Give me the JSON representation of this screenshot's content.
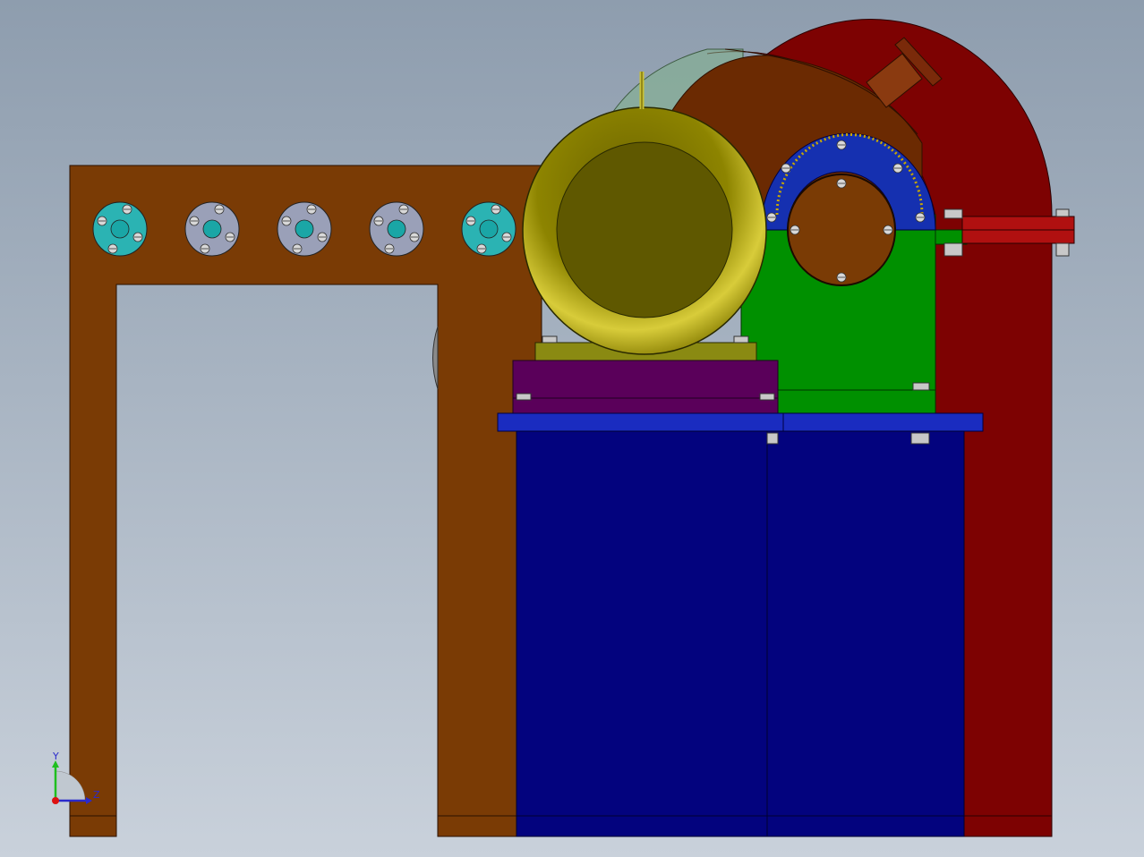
{
  "viewport": {
    "background_top": "#8e9dae",
    "background_bottom": "#c9d1db"
  },
  "triad": {
    "y_label": "Y",
    "z_label": "Z",
    "y_color": "#1fbf1f",
    "z_color": "#2a2acc",
    "x_color": "#dd1111"
  },
  "parts": {
    "frame_color": "#7a3b05",
    "housing_color": "#7d0202",
    "base_color": "#03037e",
    "motor_color": "#bfb31a",
    "gearbox_color": "#009000",
    "flange_color": "#5a005a",
    "ring_gear_color": "#1530b0",
    "bearing_colors": [
      "#2bb3b3",
      "#9aa0b8",
      "#9aa0b8",
      "#9aa0b8",
      "#2bb3b3"
    ]
  }
}
